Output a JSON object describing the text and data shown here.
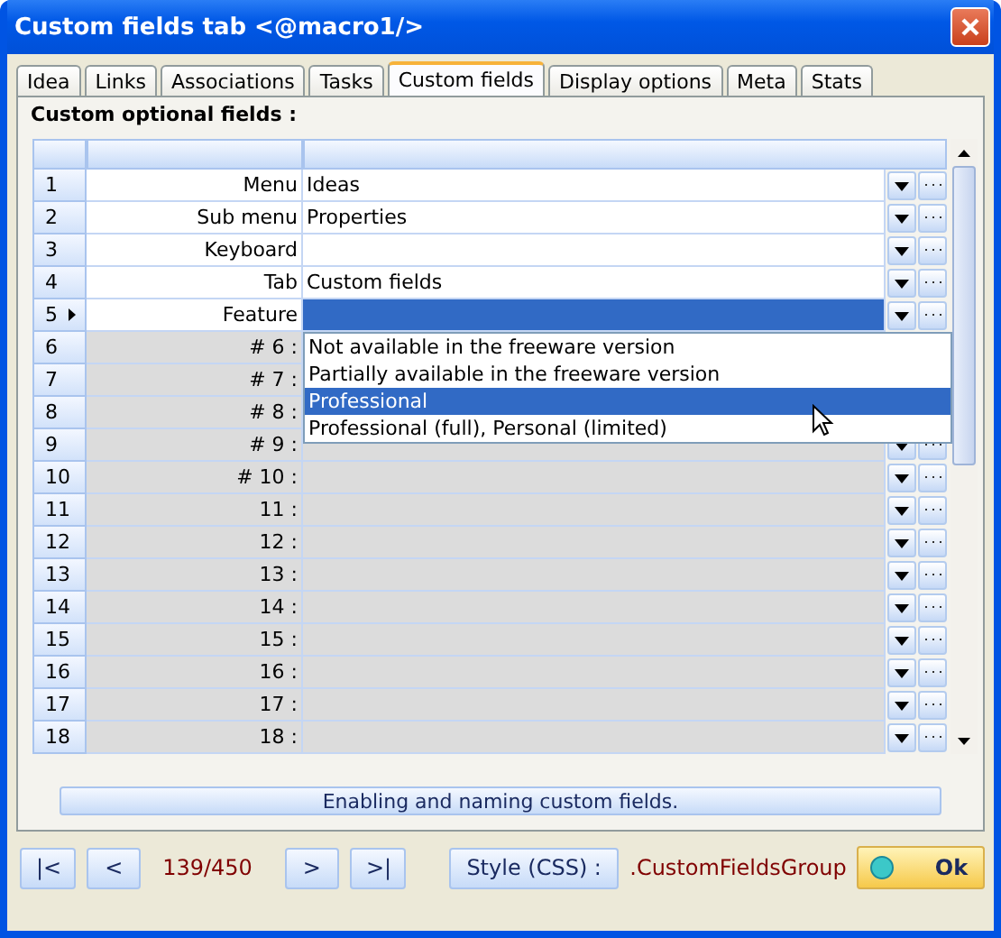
{
  "window": {
    "title": "Custom fields tab <@macro1/>"
  },
  "tabs": [
    {
      "label": "Idea",
      "selected": false
    },
    {
      "label": "Links",
      "selected": false
    },
    {
      "label": "Associations",
      "selected": false
    },
    {
      "label": "Tasks",
      "selected": false
    },
    {
      "label": "Custom fields",
      "selected": true
    },
    {
      "label": "Display options",
      "selected": false
    },
    {
      "label": "Meta",
      "selected": false
    },
    {
      "label": "Stats",
      "selected": false
    }
  ],
  "section_title": "Custom optional fields :",
  "rows": [
    {
      "number": "1",
      "label": "Menu",
      "value": "Ideas",
      "disabled": false,
      "current": false
    },
    {
      "number": "2",
      "label": "Sub menu",
      "value": "Properties",
      "disabled": false,
      "current": false
    },
    {
      "number": "3",
      "label": "Keyboard",
      "disabled": false,
      "current": false
    },
    {
      "number": "4",
      "label": "Tab",
      "value": "Custom fields",
      "disabled": false,
      "current": false
    },
    {
      "number": "5",
      "label": "Feature",
      "disabled": false,
      "current": true
    },
    {
      "number": "6",
      "label": "# 6 :",
      "disabled": true,
      "current": false
    },
    {
      "number": "7",
      "label": "# 7 :",
      "disabled": true,
      "current": false
    },
    {
      "number": "8",
      "label": "# 8 :",
      "disabled": true,
      "current": false
    },
    {
      "number": "9",
      "label": "# 9 :",
      "disabled": true,
      "current": false
    },
    {
      "number": "10",
      "label": "# 10 :",
      "disabled": true,
      "current": false
    },
    {
      "number": "11",
      "label": "11 :",
      "disabled": true,
      "current": false
    },
    {
      "number": "12",
      "label": "12 :",
      "disabled": true,
      "current": false
    },
    {
      "number": "13",
      "label": "13 :",
      "disabled": true,
      "current": false
    },
    {
      "number": "14",
      "label": "14 :",
      "disabled": true,
      "current": false
    },
    {
      "number": "15",
      "label": "15 :",
      "disabled": true,
      "current": false
    },
    {
      "number": "16",
      "label": "16 :",
      "disabled": true,
      "current": false
    },
    {
      "number": "17",
      "label": "17 :",
      "disabled": true,
      "current": false
    },
    {
      "number": "18",
      "label": "18 :",
      "disabled": true,
      "current": false
    }
  ],
  "dropdown": {
    "options": [
      {
        "label": "Not available in the freeware version",
        "selected": false
      },
      {
        "label": "Partially available in the freeware version",
        "selected": false
      },
      {
        "label": "Professional",
        "selected": true
      },
      {
        "label": "Professional (full), Personal (limited)",
        "selected": false
      }
    ]
  },
  "description": "Enabling and naming custom fields.",
  "footer": {
    "first": "|<",
    "previous": "<",
    "position": "139/450",
    "next": ">",
    "last": ">|",
    "style_button": "Style (CSS) :",
    "style_value": ".CustomFieldsGroup",
    "ok": "Ok"
  }
}
